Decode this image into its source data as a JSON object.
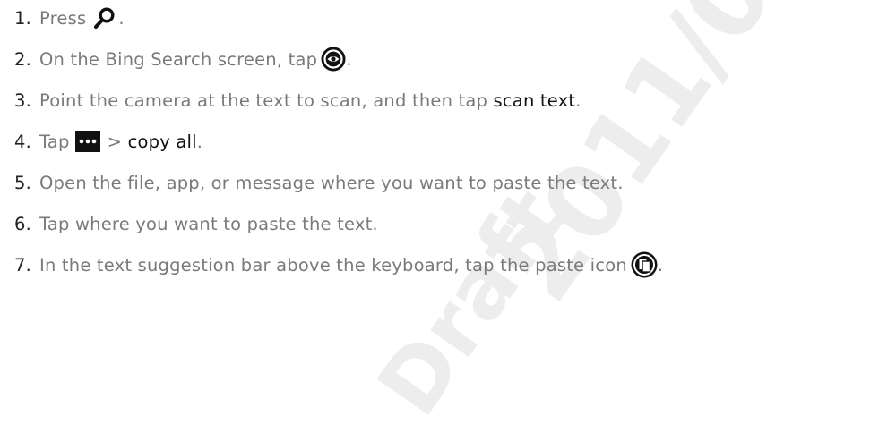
{
  "watermark": {
    "text": "2011/0",
    "line2": "Draft"
  },
  "steps": [
    {
      "number": "1.",
      "parts": [
        "Press",
        "."
      ]
    },
    {
      "number": "2.",
      "parts": [
        "On the Bing Search screen, tap",
        "."
      ]
    },
    {
      "number": "3.",
      "parts": [
        "Point the camera at the text to scan, and then tap",
        "scan text",
        "."
      ]
    },
    {
      "number": "4.",
      "parts": [
        "Tap",
        "> ",
        "copy all",
        "."
      ]
    },
    {
      "number": "5.",
      "parts": [
        "Open the file, app, or message where you want to paste the text."
      ]
    },
    {
      "number": "6.",
      "parts": [
        "Tap where you want to paste the text."
      ]
    },
    {
      "number": "7.",
      "parts": [
        "In the text suggestion bar above the keyboard, tap the paste icon",
        "."
      ]
    }
  ],
  "icons": {
    "step1": "search-icon",
    "step2": "vision-search-icon",
    "step4": "more-options-icon",
    "step7": "paste-icon"
  },
  "colors": {
    "body_text": "#7a7a7a",
    "highlight_text": "#111111",
    "icon_fill": "#111111",
    "watermark": "#ededed"
  }
}
